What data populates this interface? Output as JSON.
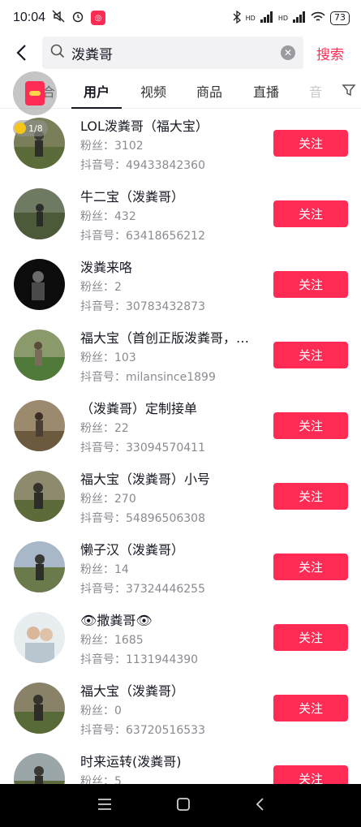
{
  "status": {
    "time": "10:04",
    "battery": "73",
    "signal_label_1": "HD",
    "signal_label_2": "HD"
  },
  "search": {
    "query": "泼粪哥",
    "submit_label": "搜索"
  },
  "tabs": [
    {
      "label": "合"
    },
    {
      "label": "用户"
    },
    {
      "label": "视频"
    },
    {
      "label": "商品"
    },
    {
      "label": "直播"
    },
    {
      "label": "音"
    }
  ],
  "float_counter": "1/8",
  "users": [
    {
      "name": "LOL泼粪哥（福大宝）",
      "fans": "粉丝：3102",
      "id": "抖音号：49433842360",
      "follow": "关注"
    },
    {
      "name": "牛二宝（泼粪哥）",
      "fans": "粉丝：432",
      "id": "抖音号：63418656212",
      "follow": "关注"
    },
    {
      "name": "泼粪来咯",
      "fans": "粉丝：2",
      "id": "抖音号：30783432873",
      "follow": "关注"
    },
    {
      "name": "福大宝（首创正版泼粪哥，…",
      "fans": "粉丝：103",
      "id": "抖音号：milansince1899",
      "follow": "关注"
    },
    {
      "name": "（泼粪哥）定制接单",
      "fans": "粉丝：22",
      "id": "抖音号：33094570411",
      "follow": "关注"
    },
    {
      "name": "福大宝（泼粪哥）小号",
      "fans": "粉丝：270",
      "id": "抖音号：54896506308",
      "follow": "关注"
    },
    {
      "name": "懒子汉（泼粪哥）",
      "fans": "粉丝：14",
      "id": "抖音号：37324446255",
      "follow": "关注"
    },
    {
      "name": "👁撒粪哥👁",
      "fans": "粉丝：1685",
      "id": "抖音号：1131944390",
      "follow": "关注"
    },
    {
      "name": "福大宝（泼粪哥）",
      "fans": "粉丝：0",
      "id": "抖音号：63720516533",
      "follow": "关注"
    },
    {
      "name": "时来运转(泼粪哥)",
      "fans": "粉丝：5",
      "id": "",
      "follow": "关注"
    }
  ],
  "colors": {
    "accent": "#fe2c55",
    "text_primary": "#161823",
    "text_secondary": "#8a8b91"
  }
}
